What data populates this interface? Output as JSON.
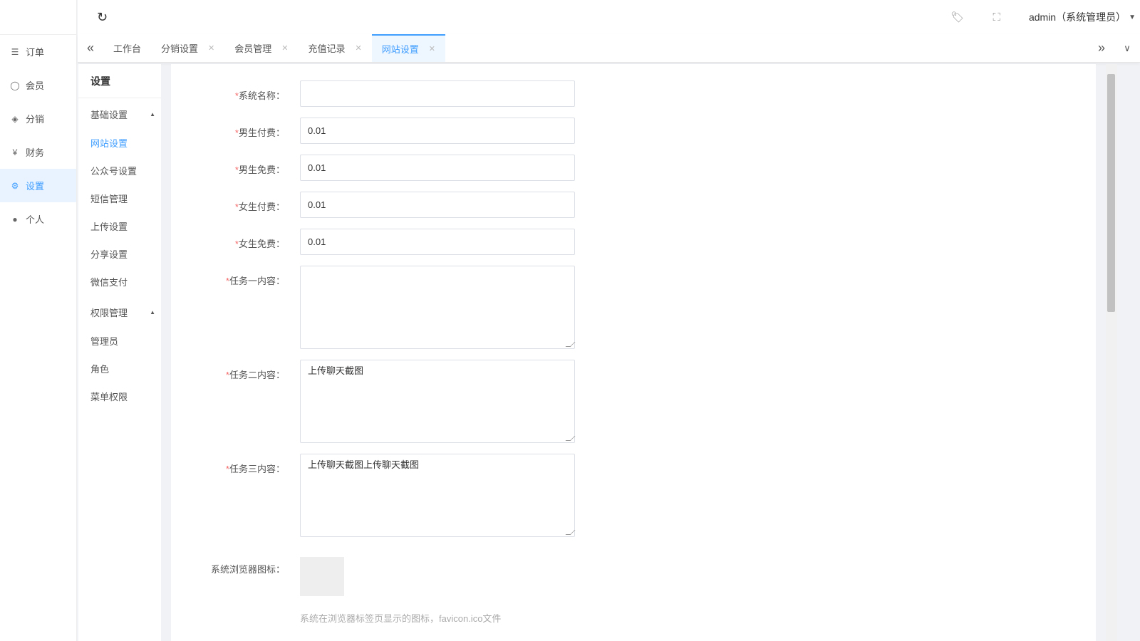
{
  "nav": [
    {
      "icon": "list-icon",
      "g": "☰",
      "label": "订单"
    },
    {
      "icon": "user-icon",
      "g": "◯",
      "label": "会员"
    },
    {
      "icon": "layers-icon",
      "g": "◈",
      "label": "分销"
    },
    {
      "icon": "money-icon",
      "g": "¥",
      "label": "财务"
    },
    {
      "icon": "gear-icon",
      "g": "⚙",
      "label": "设置",
      "active": true
    },
    {
      "icon": "person-icon",
      "g": "●",
      "label": "个人"
    }
  ],
  "topbar": {
    "user": "admin（系统管理员）"
  },
  "tabs": [
    {
      "label": "工作台"
    },
    {
      "label": "分销设置"
    },
    {
      "label": "会员管理"
    },
    {
      "label": "充值记录"
    },
    {
      "label": "网站设置"
    }
  ],
  "submenu": {
    "title": "设置",
    "group1": "基础设置",
    "items1": [
      "网站设置",
      "公众号设置",
      "短信管理",
      "上传设置",
      "分享设置",
      "微信支付"
    ],
    "group2": "权限管理",
    "items2": [
      "管理员",
      "角色",
      "菜单权限"
    ]
  },
  "form": {
    "fields": [
      {
        "label": "系统名称：",
        "value": ""
      },
      {
        "label": "男生付费：",
        "value": "0.01"
      },
      {
        "label": "男生免费：",
        "value": "0.01"
      },
      {
        "label": "女生付费：",
        "value": "0.01"
      },
      {
        "label": "女生免费：",
        "value": "0.01"
      }
    ],
    "textareas": [
      {
        "label": "任务一内容：",
        "value": ""
      },
      {
        "label": "任务二内容：",
        "value": "上传聊天截图"
      },
      {
        "label": "任务三内容：",
        "value": "上传聊天截图上传聊天截图"
      }
    ],
    "icon_label": "系统浏览器图标：",
    "icon_hint": "系统在浏览器标签页显示的图标，favicon.ico文件"
  }
}
